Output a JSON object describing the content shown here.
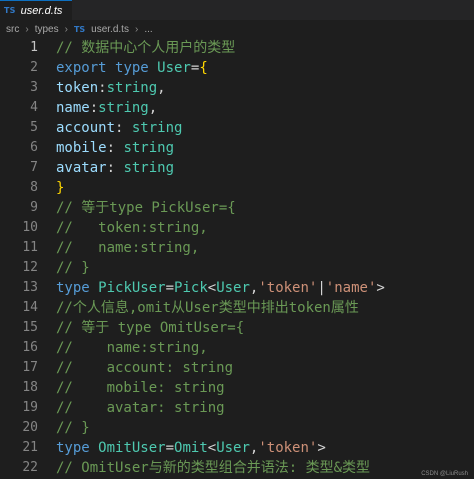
{
  "tab": {
    "badge": "TS",
    "name": "user.d.ts"
  },
  "breadcrumb": {
    "part1": "src",
    "part2": "types",
    "badge": "TS",
    "file": "user.d.ts",
    "ellipsis": "..."
  },
  "lines": [
    {
      "number": "1",
      "tokens": [
        {
          "text": "// 数据中心个人用户的类型",
          "class": "cmt"
        }
      ]
    },
    {
      "number": "2",
      "tokens": [
        {
          "text": "export",
          "class": "kw"
        },
        {
          "text": " ",
          "class": "punc"
        },
        {
          "text": "type",
          "class": "kw"
        },
        {
          "text": " ",
          "class": "punc"
        },
        {
          "text": "User",
          "class": "ty"
        },
        {
          "text": "=",
          "class": "punc"
        },
        {
          "text": "{",
          "class": "brace"
        }
      ]
    },
    {
      "number": "3",
      "tokens": [
        {
          "text": "token",
          "class": "prop"
        },
        {
          "text": ":",
          "class": "punc"
        },
        {
          "text": "string",
          "class": "ty"
        },
        {
          "text": ",",
          "class": "punc"
        }
      ]
    },
    {
      "number": "4",
      "tokens": [
        {
          "text": "name",
          "class": "prop"
        },
        {
          "text": ":",
          "class": "punc"
        },
        {
          "text": "string",
          "class": "ty"
        },
        {
          "text": ",",
          "class": "punc"
        }
      ]
    },
    {
      "number": "5",
      "tokens": [
        {
          "text": "account",
          "class": "prop"
        },
        {
          "text": ": ",
          "class": "punc"
        },
        {
          "text": "string",
          "class": "ty"
        }
      ]
    },
    {
      "number": "6",
      "tokens": [
        {
          "text": "mobile",
          "class": "prop"
        },
        {
          "text": ": ",
          "class": "punc"
        },
        {
          "text": "string",
          "class": "ty"
        }
      ]
    },
    {
      "number": "7",
      "tokens": [
        {
          "text": "avatar",
          "class": "prop"
        },
        {
          "text": ": ",
          "class": "punc"
        },
        {
          "text": "string",
          "class": "ty"
        }
      ]
    },
    {
      "number": "8",
      "tokens": [
        {
          "text": "}",
          "class": "brace"
        }
      ]
    },
    {
      "number": "9",
      "tokens": [
        {
          "text": "// 等于type PickUser={",
          "class": "cmt"
        }
      ]
    },
    {
      "number": "10",
      "tokens": [
        {
          "text": "//   token:string,",
          "class": "cmt"
        }
      ]
    },
    {
      "number": "11",
      "tokens": [
        {
          "text": "//   name:string,",
          "class": "cmt"
        }
      ]
    },
    {
      "number": "12",
      "tokens": [
        {
          "text": "// }",
          "class": "cmt"
        }
      ]
    },
    {
      "number": "13",
      "tokens": [
        {
          "text": "type",
          "class": "kw"
        },
        {
          "text": " ",
          "class": "punc"
        },
        {
          "text": "PickUser",
          "class": "ty"
        },
        {
          "text": "=",
          "class": "punc"
        },
        {
          "text": "Pick",
          "class": "ty"
        },
        {
          "text": "<",
          "class": "punc"
        },
        {
          "text": "User",
          "class": "ty"
        },
        {
          "text": ",",
          "class": "punc"
        },
        {
          "text": "'token'",
          "class": "str"
        },
        {
          "text": "|",
          "class": "punc"
        },
        {
          "text": "'name'",
          "class": "str"
        },
        {
          "text": ">",
          "class": "punc"
        }
      ]
    },
    {
      "number": "14",
      "tokens": [
        {
          "text": "//个人信息,omit从User类型中排出token属性",
          "class": "cmt"
        }
      ]
    },
    {
      "number": "15",
      "tokens": [
        {
          "text": "// 等于 type OmitUser={",
          "class": "cmt"
        }
      ]
    },
    {
      "number": "16",
      "tokens": [
        {
          "text": "//    name:string,",
          "class": "cmt"
        }
      ]
    },
    {
      "number": "17",
      "tokens": [
        {
          "text": "//    account: string",
          "class": "cmt"
        }
      ]
    },
    {
      "number": "18",
      "tokens": [
        {
          "text": "//    mobile: string",
          "class": "cmt"
        }
      ]
    },
    {
      "number": "19",
      "tokens": [
        {
          "text": "//    avatar: string",
          "class": "cmt"
        }
      ]
    },
    {
      "number": "20",
      "tokens": [
        {
          "text": "// }",
          "class": "cmt"
        }
      ]
    },
    {
      "number": "21",
      "tokens": [
        {
          "text": "type",
          "class": "kw"
        },
        {
          "text": " ",
          "class": "punc"
        },
        {
          "text": "OmitUser",
          "class": "ty"
        },
        {
          "text": "=",
          "class": "punc"
        },
        {
          "text": "Omit",
          "class": "ty"
        },
        {
          "text": "<",
          "class": "punc"
        },
        {
          "text": "User",
          "class": "ty"
        },
        {
          "text": ",",
          "class": "punc"
        },
        {
          "text": "'token'",
          "class": "str"
        },
        {
          "text": ">",
          "class": "punc"
        }
      ]
    },
    {
      "number": "22",
      "tokens": [
        {
          "text": "// OmitUser与新的类型组合并语法: 类型&类型",
          "class": "cmt"
        }
      ]
    }
  ],
  "watermark": "CSDN @LiuRush",
  "colors": {
    "background": "#1e1e1e",
    "keyword": "#569cd6",
    "type": "#4ec9b0",
    "property": "#9cdcfe",
    "string": "#ce9178",
    "comment": "#6a9955",
    "brace": "#ffd700"
  }
}
